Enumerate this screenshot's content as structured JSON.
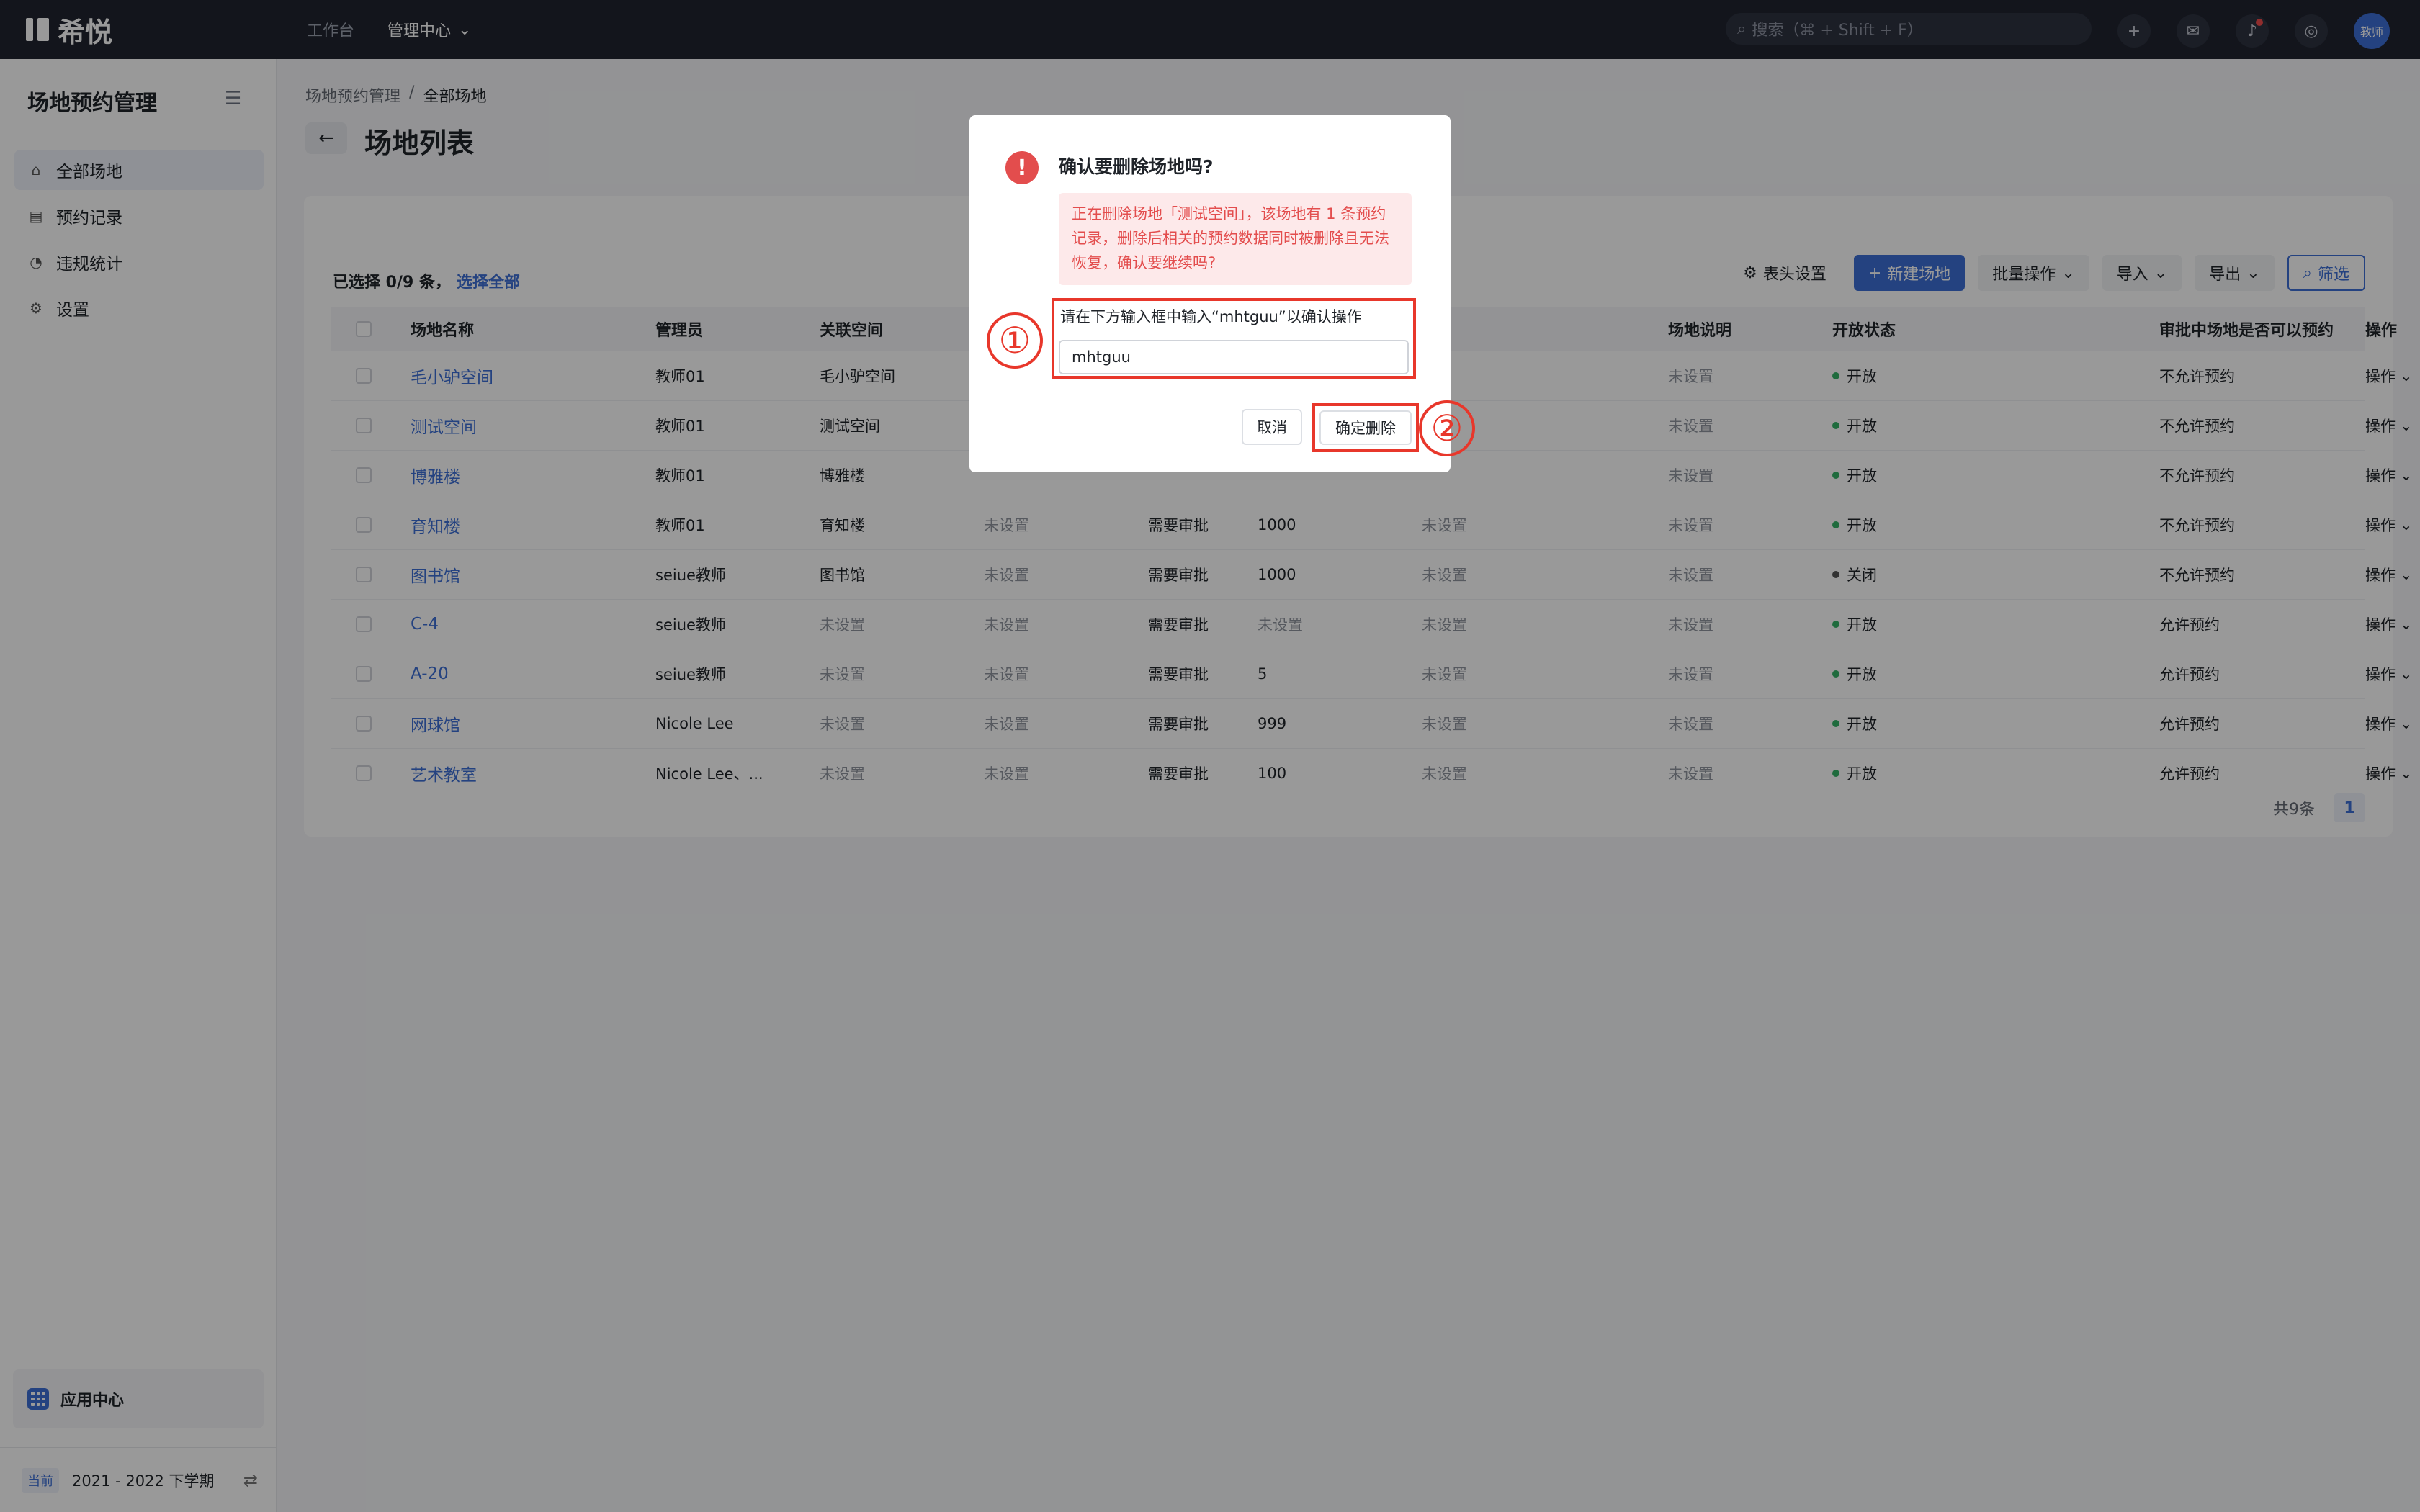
{
  "topbar": {
    "brand": "希悦",
    "nav": [
      "工作台",
      "管理中心"
    ],
    "search_placeholder": "搜索（⌘ + Shift + F）",
    "avatar_text": "教师"
  },
  "sidebar": {
    "title": "场地预约管理",
    "items": [
      {
        "label": "全部场地",
        "icon": "venue-icon",
        "active": true
      },
      {
        "label": "预约记录",
        "icon": "record-icon",
        "active": false
      },
      {
        "label": "违规统计",
        "icon": "chart-icon",
        "active": false
      },
      {
        "label": "设置",
        "icon": "gear-icon",
        "active": false
      }
    ],
    "app_center": "应用中心",
    "term_tag": "当前",
    "term": "2021 - 2022 下学期"
  },
  "main": {
    "breadcrumb": [
      "场地预约管理",
      "/",
      "全部场地"
    ],
    "title": "场地列表",
    "selection_text": "已选择 0/9 条，",
    "select_all": "选择全部",
    "tools": {
      "header_settings": "表头设置",
      "new_venue": "新建场地",
      "batch": "批量操作",
      "import": "导入",
      "export": "导出",
      "filter": "筛选"
    },
    "columns": [
      "场地名称",
      "管理员",
      "关联空间",
      "",
      "",
      "",
      "",
      "场地说明",
      "开放状态",
      "审批中场地是否可以预约",
      "操作"
    ],
    "rows": [
      [
        "毛小驴空间",
        "教师01",
        "毛小驴空间",
        "",
        "",
        "",
        "",
        "未设置",
        "开放",
        "不允许预约",
        "操作"
      ],
      [
        "测试空间",
        "教师01",
        "测试空间",
        "",
        "",
        "",
        "",
        "未设置",
        "开放",
        "不允许预约",
        "操作"
      ],
      [
        "博雅楼",
        "教师01",
        "博雅楼",
        "",
        "",
        "",
        "",
        "未设置",
        "开放",
        "不允许预约",
        "操作"
      ],
      [
        "育知楼",
        "教师01",
        "育知楼",
        "未设置",
        "需要审批",
        "1000",
        "未设置",
        "未设置",
        "开放",
        "不允许预约",
        "操作"
      ],
      [
        "图书馆",
        "seiue教师",
        "图书馆",
        "未设置",
        "需要审批",
        "1000",
        "未设置",
        "未设置",
        "关闭",
        "不允许预约",
        "操作"
      ],
      [
        "C-4",
        "seiue教师",
        "未设置",
        "未设置",
        "需要审批",
        "未设置",
        "未设置",
        "未设置",
        "开放",
        "允许预约",
        "操作"
      ],
      [
        "A-20",
        "seiue教师",
        "未设置",
        "未设置",
        "需要审批",
        "5",
        "未设置",
        "未设置",
        "开放",
        "允许预约",
        "操作"
      ],
      [
        "网球馆",
        "Nicole Lee",
        "未设置",
        "未设置",
        "需要审批",
        "999",
        "未设置",
        "未设置",
        "开放",
        "允许预约",
        "操作"
      ],
      [
        "艺术教室",
        "Nicole Lee、...",
        "未设置",
        "未设置",
        "需要审批",
        "100",
        "未设置",
        "未设置",
        "开放",
        "允许预约",
        "操作"
      ]
    ],
    "total": "共9条",
    "page": "1"
  },
  "dialog": {
    "title": "确认要删除场地吗?",
    "warning": "正在删除场地「测试空间」，该场地有 1 条预约记录，删除后相关的预约数据同时被删除且无法恢复，确认要继续吗?",
    "prompt": "请在下方输入框中输入“mhtguu”以确认操作",
    "input_value": "mhtguu",
    "cancel": "取消",
    "confirm": "确定删除",
    "marker_1": "①",
    "marker_2": "②"
  },
  "colors": {
    "primary": "#3d6fd6",
    "danger": "#e34d4d",
    "annotation": "#e8372b",
    "topbar": "#20242f"
  }
}
